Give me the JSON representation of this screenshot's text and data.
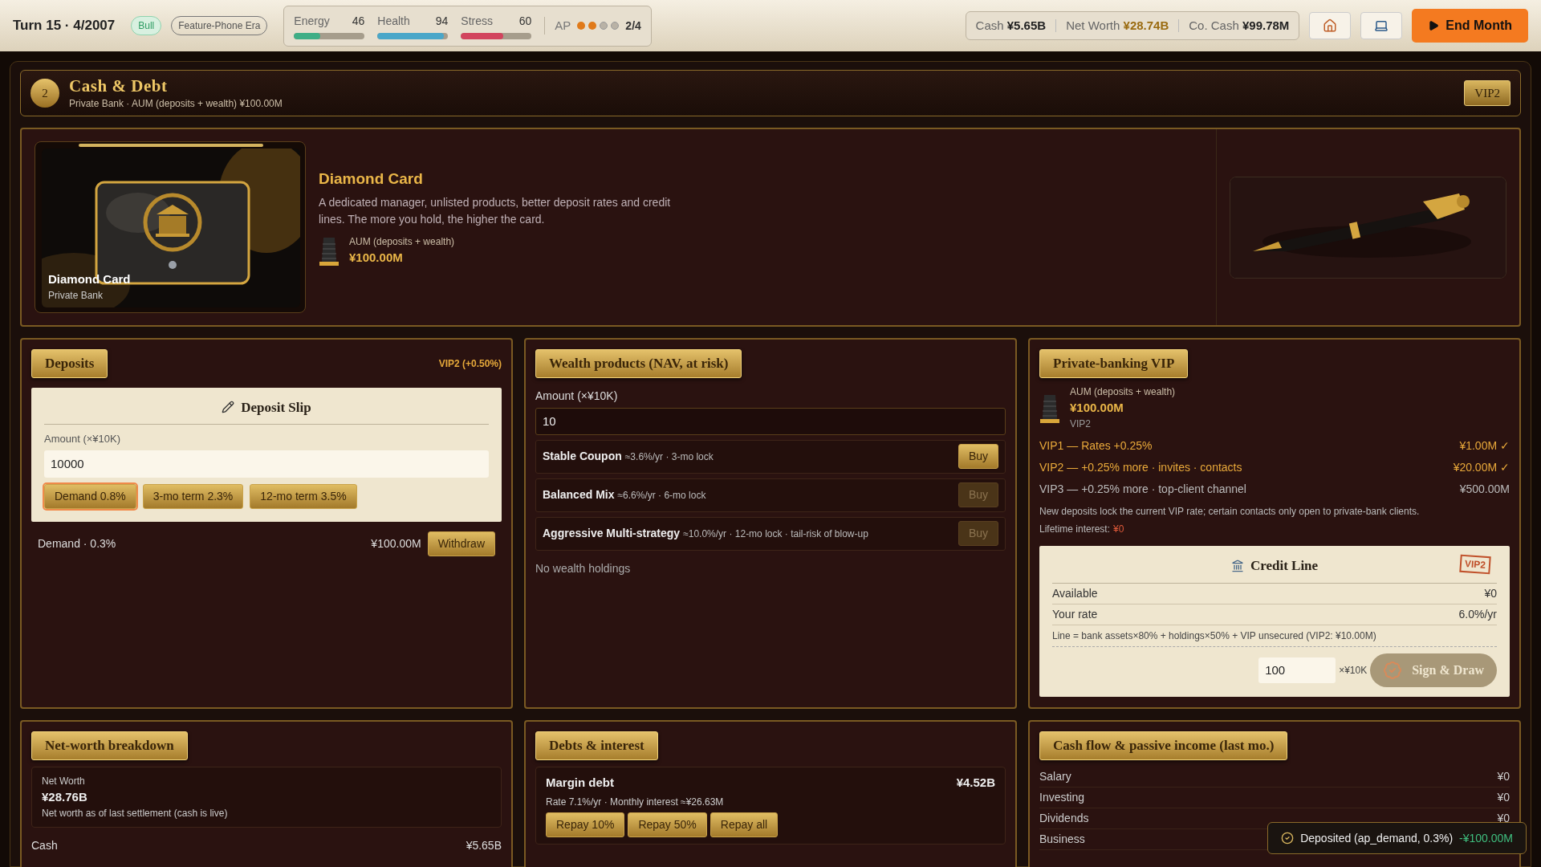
{
  "topbar": {
    "turn": "Turn 15 · 4/2007",
    "market": "Bull",
    "era": "Feature-Phone Era",
    "stats": [
      {
        "label": "Energy",
        "value": "46",
        "level": 0.37,
        "color": "#3fae86"
      },
      {
        "label": "Health",
        "value": "94",
        "level": 0.94,
        "color": "#4aa7c9"
      },
      {
        "label": "Stress",
        "value": "60",
        "level": 0.6,
        "color": "#d2445e"
      }
    ],
    "ap": {
      "label": "AP",
      "dots": [
        {
          "filled": true
        },
        {
          "filled": true
        },
        {
          "filled": false
        },
        {
          "filled": false
        }
      ],
      "count": "2/4"
    },
    "finance": [
      {
        "label": "Cash",
        "value": "¥5.65B",
        "highlight": false
      },
      {
        "label": "Net Worth",
        "value": "¥28.74B",
        "highlight": true
      },
      {
        "label": "Co. Cash",
        "value": "¥99.78M",
        "highlight": false
      }
    ],
    "end_button": "End Month"
  },
  "section": {
    "number": "2",
    "title": "Cash & Debt",
    "subtitle": "Private Bank · AUM (deposits + wealth) ¥100.00M",
    "badge": "VIP2"
  },
  "hero": {
    "card_title": "Diamond Card",
    "card_subtitle": "Private Bank",
    "title": "Diamond Card",
    "description": "A dedicated manager, unlisted products, better deposit rates and credit lines. The more you hold, the higher the card.",
    "aum_label": "AUM (deposits + wealth)",
    "aum_value": "¥100.00M"
  },
  "deposits": {
    "title": "Deposits",
    "rate_badge": "VIP2 (+0.50%)",
    "slip": {
      "title": "Deposit Slip",
      "amount_label": "Amount (×¥10K)",
      "amount_value": "10000",
      "options": [
        {
          "label": "Demand 0.8%",
          "selected": true
        },
        {
          "label": "3-mo term 2.3%",
          "selected": false
        },
        {
          "label": "12-mo term 3.5%",
          "selected": false
        }
      ]
    },
    "holdings": [
      {
        "label": "Demand · 0.3%",
        "value": "¥100.00M",
        "action": "Withdraw"
      }
    ]
  },
  "wealth": {
    "title": "Wealth products (NAV, at risk)",
    "amount_label": "Amount (×¥10K)",
    "amount_value": "10",
    "products": [
      {
        "name": "Stable Coupon",
        "details": "≈3.6%/yr · 3-mo lock",
        "action": "Buy",
        "disabled": false
      },
      {
        "name": "Balanced Mix",
        "details": "≈6.6%/yr · 6-mo lock",
        "action": "Buy",
        "disabled": true
      },
      {
        "name": "Aggressive Multi-strategy",
        "details": "≈10.0%/yr · 12-mo lock · tail-risk of blow-up",
        "action": "Buy",
        "disabled": true
      }
    ],
    "empty": "No wealth holdings"
  },
  "vip": {
    "title": "Private-banking VIP",
    "aum_label": "AUM (deposits + wealth)",
    "aum_value": "¥100.00M",
    "level": "VIP2",
    "tiers": [
      {
        "label": "VIP1 — Rates +0.25%",
        "threshold": "¥1.00M ✓",
        "reached": true
      },
      {
        "label": "VIP2 — +0.25% more · invites · contacts",
        "threshold": "¥20.00M ✓",
        "reached": true
      },
      {
        "label": "VIP3 — +0.25% more · top-client channel",
        "threshold": "¥500.00M",
        "reached": false
      }
    ],
    "note": "New deposits lock the current VIP rate; certain contacts only open to private-bank clients.",
    "lifetime_label": "Lifetime interest:",
    "lifetime_value": "¥0",
    "credit_line": {
      "title": "Credit Line",
      "stamp": "VIP2",
      "rows": [
        {
          "label": "Available",
          "value": "¥0"
        },
        {
          "label": "Your rate",
          "value": "6.0%/yr"
        }
      ],
      "formula": "Line = bank assets×80% + holdings×50% + VIP unsecured (VIP2: ¥10.00M)",
      "amount_value": "100",
      "unit": "×¥10K",
      "action": "Sign & Draw",
      "disabled": true
    }
  },
  "net_worth": {
    "title": "Net-worth breakdown",
    "summary_label": "Net Worth",
    "summary_value": "¥28.76B",
    "summary_note": "Net worth as of last settlement (cash is live)",
    "rows": [
      {
        "label": "Cash",
        "value": "¥5.65B"
      }
    ]
  },
  "debts": {
    "title": "Debts & interest",
    "items": [
      {
        "name": "Margin debt",
        "value": "¥4.52B",
        "details": "Rate 7.1%/yr · Monthly interest ≈¥26.63M",
        "actions": [
          "Repay 10%",
          "Repay 50%",
          "Repay all"
        ]
      }
    ]
  },
  "cash_flow": {
    "title": "Cash flow & passive income (last mo.)",
    "rows": [
      {
        "label": "Salary",
        "value": "¥0"
      },
      {
        "label": "Investing",
        "value": "¥0"
      },
      {
        "label": "Dividends",
        "value": "¥0"
      },
      {
        "label": "Business"
      }
    ]
  },
  "toast": {
    "message": "Deposited (ap_demand, 0.3%)",
    "amount": "-¥100.00M"
  }
}
